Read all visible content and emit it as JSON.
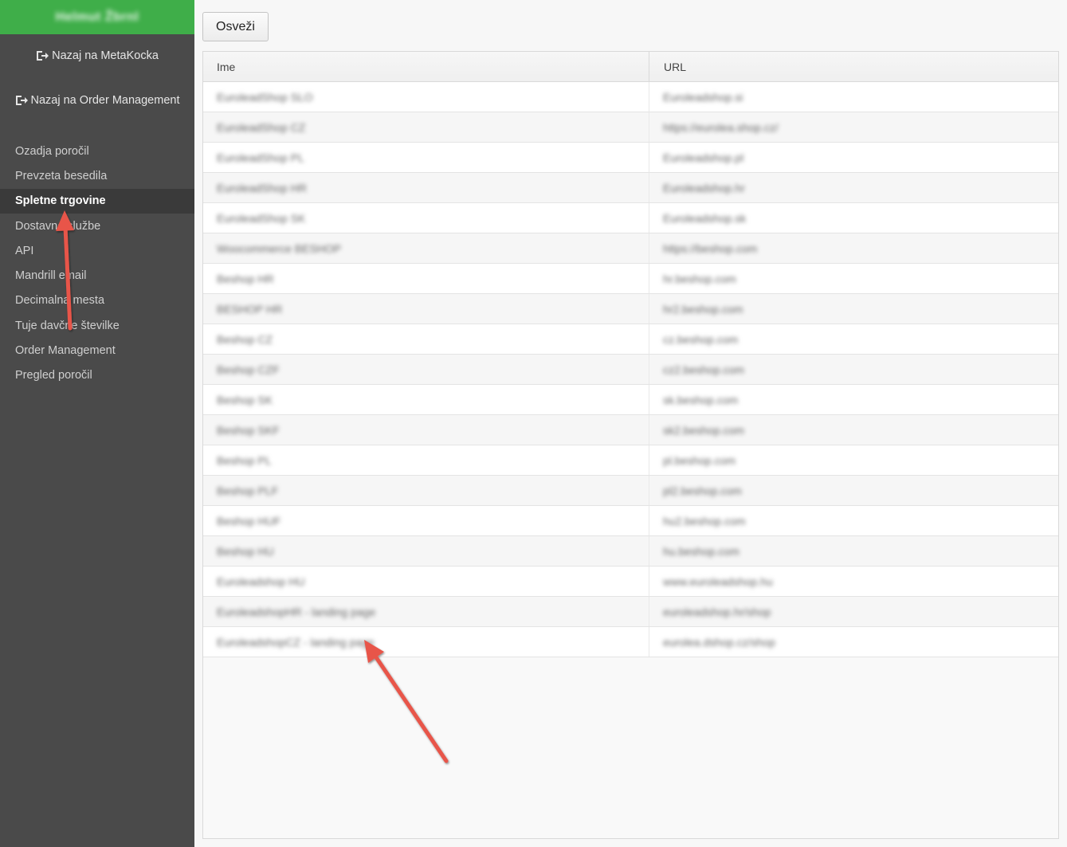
{
  "sidebar": {
    "brand": "Helmut Žbrnl",
    "back_links": [
      {
        "label": "Nazaj na MetaKocka",
        "icon": "exit-icon"
      },
      {
        "label": "Nazaj na Order Management",
        "icon": "exit-icon"
      }
    ],
    "items": [
      {
        "label": "Ozadja poročil"
      },
      {
        "label": "Prevzeta besedila"
      },
      {
        "label": "Spletne trgovine",
        "active": true
      },
      {
        "label": "Dostavne službe"
      },
      {
        "label": "API"
      },
      {
        "label": "Mandrill email"
      },
      {
        "label": "Decimalna mesta"
      },
      {
        "label": "Tuje davčne številke"
      },
      {
        "label": "Order Management"
      },
      {
        "label": "Pregled poročil"
      }
    ]
  },
  "toolbar": {
    "refresh_label": "Osveži"
  },
  "grid": {
    "columns": [
      "Ime",
      "URL"
    ],
    "rows": [
      {
        "name": "EuroleadShop SLO",
        "url": "Euroleadshop.si"
      },
      {
        "name": "EuroleadShop CZ",
        "url": "https://eurolea.shop.cz/"
      },
      {
        "name": "EuroleadShop PL",
        "url": "Euroleadshop.pl"
      },
      {
        "name": "EuroleadShop HR",
        "url": "Euroleadshop.hr"
      },
      {
        "name": "EuroleadShop SK",
        "url": "Euroleadshop.sk"
      },
      {
        "name": "Woocommerce BESHOP",
        "url": "https://beshop.com"
      },
      {
        "name": "Beshop HR",
        "url": "hr.beshop.com"
      },
      {
        "name": "BESHOP HR",
        "url": "hr2.beshop.com"
      },
      {
        "name": "Beshop CZ",
        "url": "cz.beshop.com"
      },
      {
        "name": "Beshop CZF",
        "url": "cz2.beshop.com"
      },
      {
        "name": "Beshop SK",
        "url": "sk.beshop.com"
      },
      {
        "name": "Beshop SKF",
        "url": "sk2.beshop.com"
      },
      {
        "name": "Beshop PL",
        "url": "pl.beshop.com"
      },
      {
        "name": "Beshop PLF",
        "url": "pl2.beshop.com"
      },
      {
        "name": "Beshop HUF",
        "url": "hu2.beshop.com"
      },
      {
        "name": "Beshop HU",
        "url": "hu.beshop.com"
      },
      {
        "name": "Euroleadshop HU",
        "url": "www.euroleadshop.hu"
      },
      {
        "name": "EuroleadshopHR - landing page",
        "url": "euroleadshop.hr/shop"
      },
      {
        "name": "EuroleadshopCZ - landing page",
        "url": "eurolea.dshop.cz/shop"
      }
    ]
  },
  "colors": {
    "sidebar_bg": "#4a4a4a",
    "header_green": "#3fae49",
    "active_item_bg": "#3a3a3a",
    "annotation_arrow": "#e8554a"
  }
}
